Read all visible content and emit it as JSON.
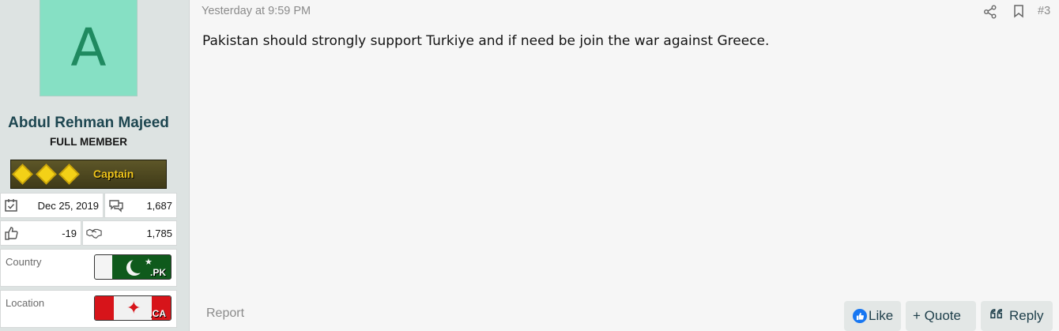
{
  "user": {
    "avatar_letter": "A",
    "avatar_color": "#86e0c4",
    "name": "Abdul Rehman Majeed",
    "title": "FULL MEMBER",
    "rank": "Captain",
    "stats": {
      "joined": "Dec 25, 2019",
      "messages": "1,687",
      "reactions": "-19",
      "points": "1,785"
    },
    "country_label": "Country",
    "country_tld": ".PK",
    "location_label": "Location",
    "location_tld": ".CA"
  },
  "post": {
    "timestamp": "Yesterday at 9:59 PM",
    "number": "#3",
    "message": "Pakistan should strongly support Turkiye and if need be join the war against Greece."
  },
  "actions": {
    "report": "Report",
    "like": "Like",
    "quote": "+ Quote",
    "reply": "Reply"
  },
  "colors": {
    "accent": "#1d3e4a",
    "like_blue": "#1877f2"
  }
}
